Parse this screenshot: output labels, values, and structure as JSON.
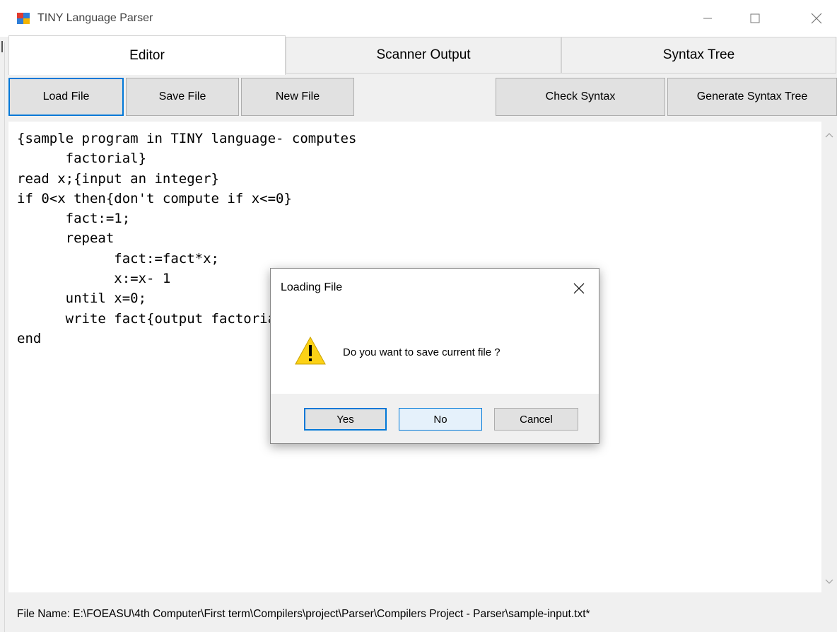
{
  "window": {
    "title": "TINY Language Parser",
    "icon": "app-window-icon",
    "controls": [
      "minimize-icon",
      "maximize-icon",
      "close-icon"
    ]
  },
  "tabs": [
    {
      "label": "Editor",
      "active": true
    },
    {
      "label": "Scanner Output",
      "active": false
    },
    {
      "label": "Syntax Tree",
      "active": false
    }
  ],
  "toolbar": {
    "load_label": "Load File",
    "save_label": "Save File",
    "new_label": "New File",
    "check_label": "Check Syntax",
    "generate_label": "Generate Syntax Tree"
  },
  "editor": {
    "code": "{sample program in TINY language- computes\n\tfactorial}\nread x;{input an integer}\nif 0<x then{don't compute if x<=0}\n\tfact:=1;\n\trepeat\n\t\tfact:=fact*x;\n\t\tx:=x- 1\n\tuntil x=0;\n\twrite fact{output factorial of x}\nend"
  },
  "status": {
    "file_name": "File Name:  E:\\FOEASU\\4th Computer\\First term\\Compilers\\project\\Parser\\Compilers Project - Parser\\sample-input.txt*"
  },
  "dialog": {
    "title": "Loading File",
    "message": "Do you want to save current file ?",
    "icon": "warning-icon",
    "yes_label": "Yes",
    "no_label": "No",
    "cancel_label": "Cancel"
  },
  "colors": {
    "accent": "#0078d7",
    "warning": "#fcd116"
  }
}
